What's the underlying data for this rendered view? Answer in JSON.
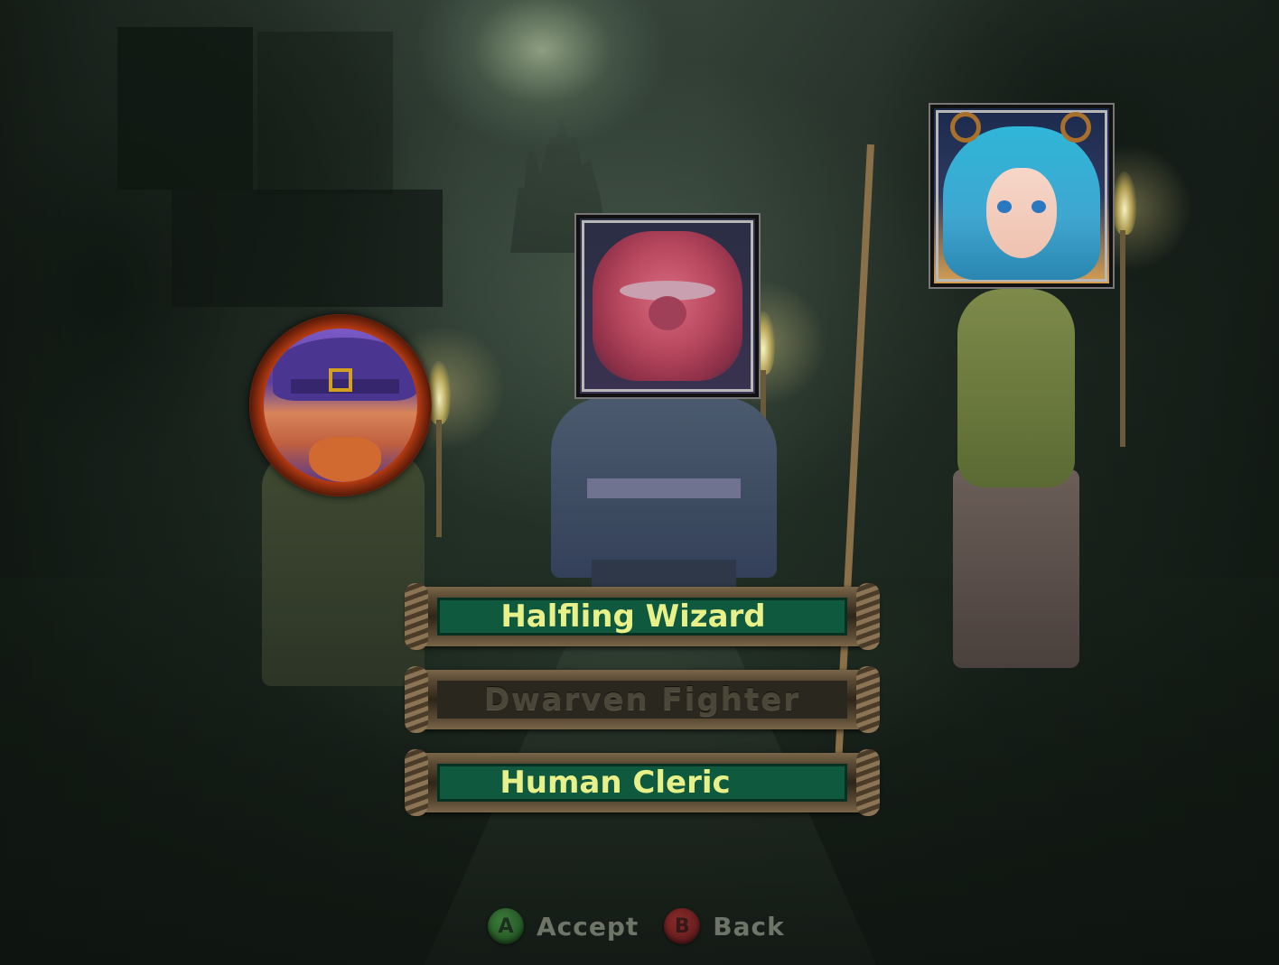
{
  "menu": {
    "items": [
      {
        "label": "Halfling Wizard",
        "state": "active"
      },
      {
        "label": "Dwarven Fighter",
        "state": "disabled"
      },
      {
        "label": "Human Cleric",
        "state": "active"
      }
    ]
  },
  "footer": {
    "accept": {
      "button": "A",
      "label": "Accept",
      "color": "#2a6a2a"
    },
    "back": {
      "button": "B",
      "label": "Back",
      "color": "#7a2424"
    }
  },
  "portraits": [
    {
      "icon": "halfling-wizard-portrait-icon"
    },
    {
      "icon": "dwarf-fighter-portrait-icon"
    },
    {
      "icon": "human-cleric-portrait-icon"
    }
  ],
  "colors": {
    "menu_active_bg": "#0f5a3e",
    "menu_active_text": "#e8f08a",
    "menu_disabled_text": "#4a4738"
  }
}
